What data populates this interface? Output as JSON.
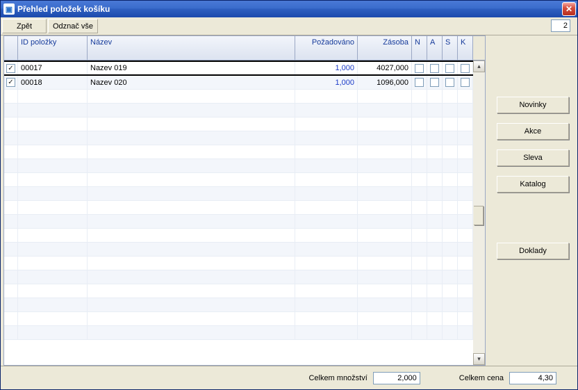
{
  "window": {
    "title": "Přehled položek košíku"
  },
  "toolbar": {
    "back": "Zpět",
    "select_all": "Odznač vše",
    "count": "2"
  },
  "grid": {
    "headers": {
      "id": "ID položky",
      "name": "Název",
      "requested": "Požadováno",
      "stock": "Zásoba",
      "n": "N",
      "a": "A",
      "s": "S",
      "k": "K"
    },
    "rows": [
      {
        "checked": true,
        "id": "00017",
        "name": "Nazev 019",
        "requested": "1,000",
        "stock": "4027,000",
        "n": false,
        "a": false,
        "s": false,
        "k": false,
        "selected": true
      },
      {
        "checked": true,
        "id": "00018",
        "name": "Nazev 020",
        "requested": "1,000",
        "stock": "1096,000",
        "n": false,
        "a": false,
        "s": false,
        "k": false,
        "selected": false
      }
    ]
  },
  "side": {
    "novinky": "Novinky",
    "akce": "Akce",
    "sleva": "Sleva",
    "katalog": "Katalog",
    "doklady": "Doklady"
  },
  "footer": {
    "qty_label": "Celkem množství",
    "qty_value": "2,000",
    "price_label": "Celkem cena",
    "price_value": "4,30"
  },
  "icons": {
    "close": "✕",
    "check": "✓",
    "up": "▴",
    "down": "▾"
  }
}
